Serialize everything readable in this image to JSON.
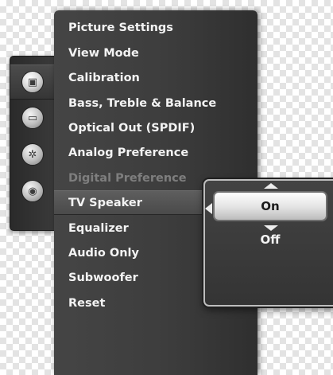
{
  "rail": {
    "items": [
      {
        "icon": "picture-icon",
        "glyph": "▣",
        "selected": true
      },
      {
        "icon": "sound-icon",
        "glyph": "▭",
        "selected": false
      },
      {
        "icon": "settings-icon",
        "glyph": "✲",
        "selected": false
      },
      {
        "icon": "camera-icon",
        "glyph": "◉",
        "selected": false
      }
    ]
  },
  "menu": {
    "items": [
      {
        "label": "Picture Settings"
      },
      {
        "label": "View Mode"
      },
      {
        "label": "Calibration"
      },
      {
        "label": "Bass, Treble & Balance"
      },
      {
        "label": "Optical Out (SPDIF)"
      },
      {
        "label": "Analog Preference"
      },
      {
        "label": "Digital Preference",
        "disabled": true
      },
      {
        "label": "TV Speaker",
        "selected": true
      },
      {
        "label": "Equalizer"
      },
      {
        "label": "Audio Only"
      },
      {
        "label": "Subwoofer"
      },
      {
        "label": "Reset"
      }
    ]
  },
  "popup": {
    "selected_option": "On",
    "next_option": "Off"
  }
}
